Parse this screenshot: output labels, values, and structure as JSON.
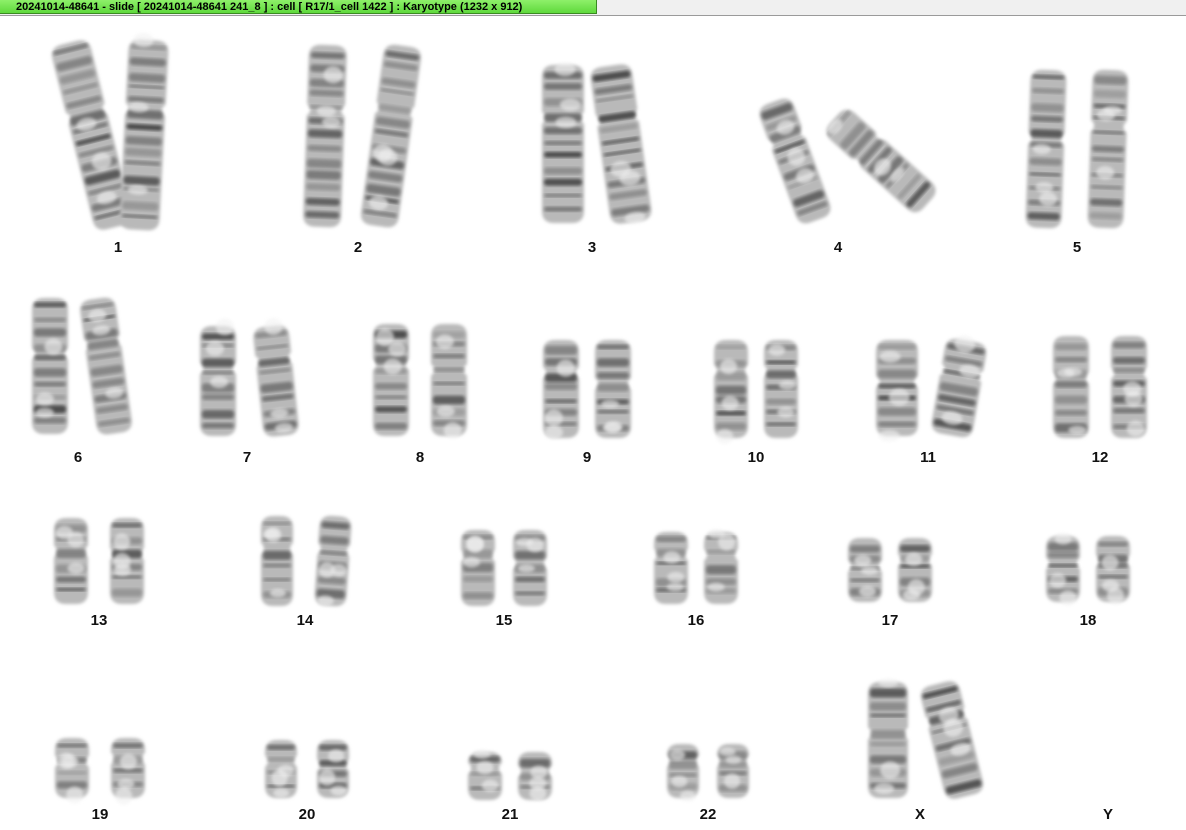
{
  "window": {
    "title": "20241014-48641 - slide [ 20241014-48641 241_8 ] : cell [ R17/1_cell 1422 ] : Karyotype  (1232 x 912)"
  },
  "karyotype": {
    "chromosomes": [
      {
        "id": "chr1",
        "label": "1"
      },
      {
        "id": "chr2",
        "label": "2"
      },
      {
        "id": "chr3",
        "label": "3"
      },
      {
        "id": "chr4",
        "label": "4"
      },
      {
        "id": "chr5",
        "label": "5"
      },
      {
        "id": "chr6",
        "label": "6"
      },
      {
        "id": "chr7",
        "label": "7"
      },
      {
        "id": "chr8",
        "label": "8"
      },
      {
        "id": "chr9",
        "label": "9"
      },
      {
        "id": "chr10",
        "label": "10"
      },
      {
        "id": "chr11",
        "label": "11"
      },
      {
        "id": "chr12",
        "label": "12"
      },
      {
        "id": "chr13",
        "label": "13"
      },
      {
        "id": "chr14",
        "label": "14"
      },
      {
        "id": "chr15",
        "label": "15"
      },
      {
        "id": "chr16",
        "label": "16"
      },
      {
        "id": "chr17",
        "label": "17"
      },
      {
        "id": "chr18",
        "label": "18"
      },
      {
        "id": "chr19",
        "label": "19"
      },
      {
        "id": "chr20",
        "label": "20"
      },
      {
        "id": "chr21",
        "label": "21"
      },
      {
        "id": "chr22",
        "label": "22"
      },
      {
        "id": "chrX",
        "label": "X"
      },
      {
        "id": "chrY",
        "label": "Y"
      }
    ]
  }
}
